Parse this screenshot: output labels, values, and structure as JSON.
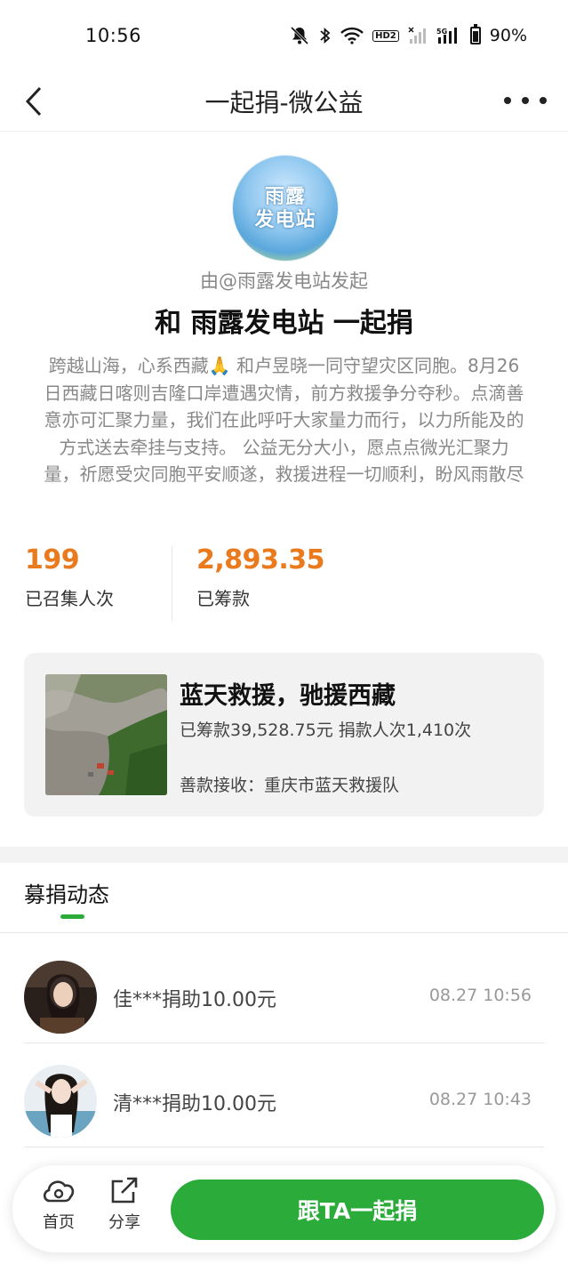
{
  "status_bar": {
    "time": "10:56",
    "battery": "90%",
    "network": "5G",
    "hd_label": "HD2"
  },
  "nav": {
    "title": "一起捐-微公益"
  },
  "header": {
    "avatar_text_line1": "雨露",
    "avatar_text_line2": "发电站",
    "initiated_by": "由@雨露发电站发起",
    "headline": "和 雨露发电站 一起捐",
    "description": "跨越山海，心系西藏🙏 和卢昱晓一同守望灾区同胞。8月26日西藏日喀则吉隆口岸遭遇灾情，前方救援争分夺秒。点滴善意亦可汇聚力量，我们在此呼吁大家量力而行，以力所能及的方式送去牵挂与支持。 公益无分大小，愿点点微光汇聚力量，祈愿受灾同胞平安顺遂，救援进程一切顺利，盼风雨散尽"
  },
  "stats": {
    "people_value": "199",
    "people_label": "已召集人次",
    "amount_value": "2,893.35",
    "amount_label": "已筹款"
  },
  "project": {
    "title": "蓝天救援，驰援西藏",
    "stats": "已筹款39,528.75元  捐款人次1,410次",
    "receiver": "善款接收：重庆市蓝天救援队"
  },
  "feed": {
    "tab_label": "募捐动态",
    "items": [
      {
        "text": "佳***捐助10.00元",
        "time": "08.27 10:56"
      },
      {
        "text": "清***捐助10.00元",
        "time": "08.27 10:43"
      }
    ]
  },
  "bottom_bar": {
    "home_label": "首页",
    "share_label": "分享",
    "donate_label": "跟TA一起捐"
  },
  "colors": {
    "accent_green": "#2bac3a",
    "stat_orange": "#ea7a1e"
  }
}
